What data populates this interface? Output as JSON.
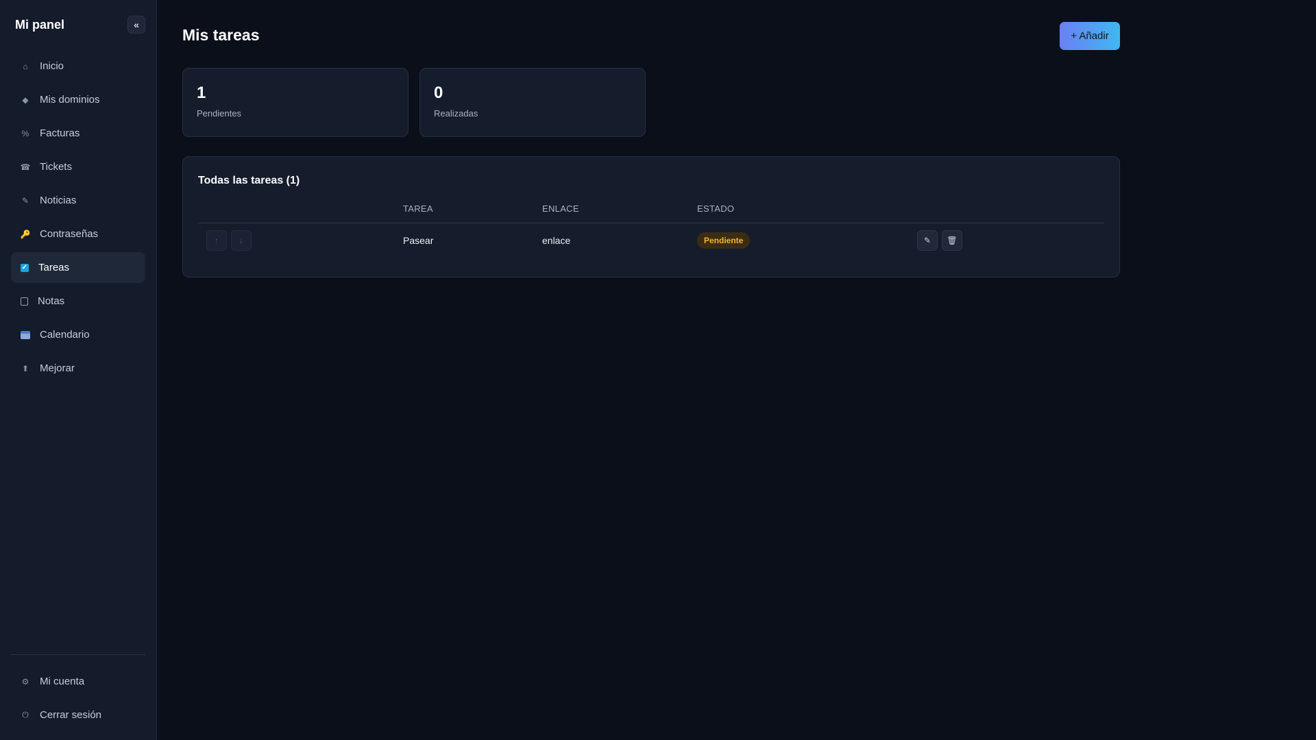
{
  "sidebar": {
    "brand": "Mi panel",
    "collapse_icon": "«",
    "items": [
      {
        "label": "Inicio",
        "icon": "home-icon",
        "glyph": "⌂"
      },
      {
        "label": "Mis dominios",
        "icon": "diamond-icon",
        "glyph": "◆"
      },
      {
        "label": "Facturas",
        "icon": "percent-icon",
        "glyph": "%"
      },
      {
        "label": "Tickets",
        "icon": "ticket-icon",
        "glyph": "☎"
      },
      {
        "label": "Noticias",
        "icon": "pencil-icon",
        "glyph": "✎"
      },
      {
        "label": "Contraseñas",
        "icon": "key-icon",
        "glyph": "🔑"
      },
      {
        "label": "Tareas",
        "icon": "checkbox-icon",
        "glyph": "✓"
      },
      {
        "label": "Notas",
        "icon": "note-icon",
        "glyph": ""
      },
      {
        "label": "Calendario",
        "icon": "calendar-icon",
        "glyph": ""
      },
      {
        "label": "Mejorar",
        "icon": "arrow-up-icon",
        "glyph": "⬆"
      }
    ],
    "active": "Tareas",
    "bottom_items": [
      {
        "label": "Mi cuenta",
        "icon": "gear-icon",
        "glyph": "⚙"
      },
      {
        "label": "Cerrar sesión",
        "icon": "power-icon",
        "glyph": "⏻"
      }
    ]
  },
  "header": {
    "title": "Mis tareas",
    "add_label": "+ Añadir"
  },
  "stats": [
    {
      "value": "1",
      "label": "Pendientes"
    },
    {
      "value": "0",
      "label": "Realizadas"
    }
  ],
  "tasks": {
    "title": "Todas las tareas (1)",
    "columns": {
      "task": "TAREA",
      "link": "ENLACE",
      "status": "ESTADO"
    },
    "rows": [
      {
        "task": "Pasear",
        "link": "enlace",
        "status": "Pendiente",
        "move_up": "↑",
        "move_down": "↓",
        "edit": "✎",
        "delete": "🗑"
      }
    ]
  },
  "colors": {
    "background": "#0b0f1a",
    "sidebar": "#141b2b",
    "card": "#151c2c",
    "accent_gradient_start": "#6b7ff5",
    "accent_gradient_end": "#3fb8f0",
    "status_pending_text": "#f2b533"
  }
}
